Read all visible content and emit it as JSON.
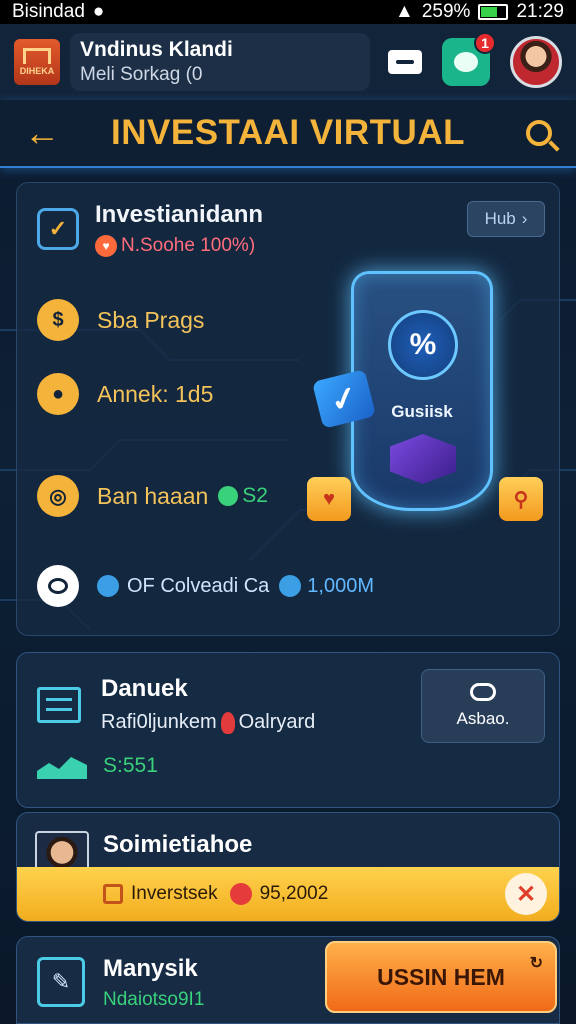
{
  "status_bar": {
    "carrier": "Bisindad",
    "battery": "259%",
    "time": "21:29"
  },
  "header": {
    "logo_text": "DIHEKA",
    "account_name": "Vndinus Klandi",
    "account_sub": "Meli Sorkag (0",
    "notification_count": "1"
  },
  "title_bar": {
    "title": "INVESTAAI VIRTUAL"
  },
  "main_card": {
    "title": "Investianidann",
    "subtitle": "N.Soohe 100%)",
    "hub_button": "Hub",
    "rows": [
      {
        "label": "Sba Prags"
      },
      {
        "label": "Annek: 1d5"
      },
      {
        "label": "Ban haaan",
        "value": "S2"
      },
      {
        "label": "OF Colveadi Ca",
        "value": "1,000M"
      }
    ],
    "shield_percent": "%",
    "shield_label": "Gusiisk"
  },
  "report_card": {
    "title": "Danuek",
    "subtitle_left": "Rafi0ljunkem",
    "subtitle_right": "Oalryard",
    "chart_value": "S:551",
    "button_label": "Asbao."
  },
  "user_card": {
    "name": "Soimietiahoe",
    "band_label": "Inverstsek",
    "band_value": "95,2002"
  },
  "bottom_card": {
    "title": "Manysik",
    "subtitle": "Ndaiotso9I1",
    "cta_label": "USSIN HEM"
  },
  "colors": {
    "accent": "#f4b33a",
    "positive": "#39d17a",
    "alert": "#e52b2b",
    "cta": "#f06a17"
  }
}
